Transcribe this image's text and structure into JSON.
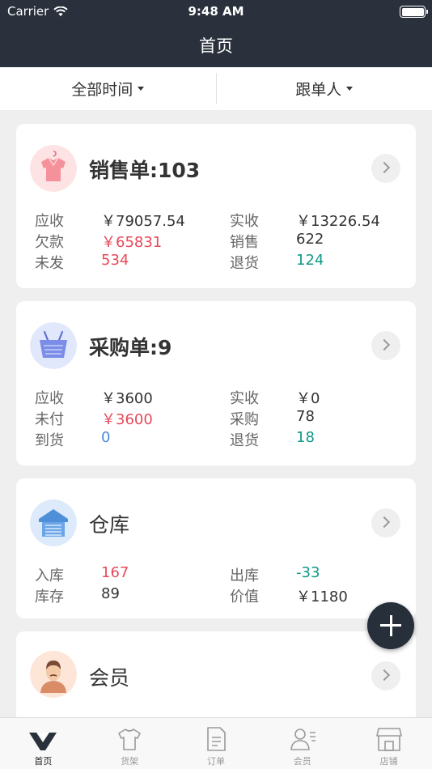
{
  "status_bar": {
    "carrier": "Carrier",
    "time": "9:48 AM"
  },
  "nav": {
    "title": "首页"
  },
  "filters": [
    {
      "label": "全部时间"
    },
    {
      "label": "跟单人"
    }
  ],
  "sales": {
    "title": "销售单:103",
    "rows": [
      {
        "l1": "应收",
        "v1": "￥79057.54",
        "l2": "实收",
        "v2": "￥13226.54"
      },
      {
        "l1": "欠款",
        "v1": "￥65831",
        "l2": "销售",
        "v2": "622"
      },
      {
        "l1": "未发",
        "v1": "534",
        "l2": "退货",
        "v2": "124"
      }
    ]
  },
  "purchase": {
    "title": "采购单:9",
    "rows": [
      {
        "l1": "应收",
        "v1": "￥3600",
        "l2": "实收",
        "v2": "￥0"
      },
      {
        "l1": "未付",
        "v1": "￥3600",
        "l2": "采购",
        "v2": "78"
      },
      {
        "l1": "到货",
        "v1": "0",
        "l2": "退货",
        "v2": "18"
      }
    ]
  },
  "warehouse": {
    "title": "仓库",
    "rows": [
      {
        "l1": "入库",
        "v1": "167",
        "l2": "出库",
        "v2": "-33"
      },
      {
        "l1": "库存",
        "v1": "89",
        "l2": "价值",
        "v2": "￥1180"
      }
    ]
  },
  "members": {
    "title": "会员"
  },
  "tabbar": {
    "items": [
      {
        "label": "首页",
        "icon": "home-logo-icon",
        "active": true
      },
      {
        "label": "货架",
        "icon": "tshirt-icon",
        "active": false
      },
      {
        "label": "订单",
        "icon": "document-icon",
        "active": false
      },
      {
        "label": "会员",
        "icon": "member-icon",
        "active": false
      },
      {
        "label": "店铺",
        "icon": "store-icon",
        "active": false
      }
    ]
  },
  "colors": {
    "header_bg": "#2a313c",
    "red": "#e8495a",
    "teal": "#0f9a88",
    "blue": "#4b8ad8",
    "fab_bg": "#272f3b"
  }
}
